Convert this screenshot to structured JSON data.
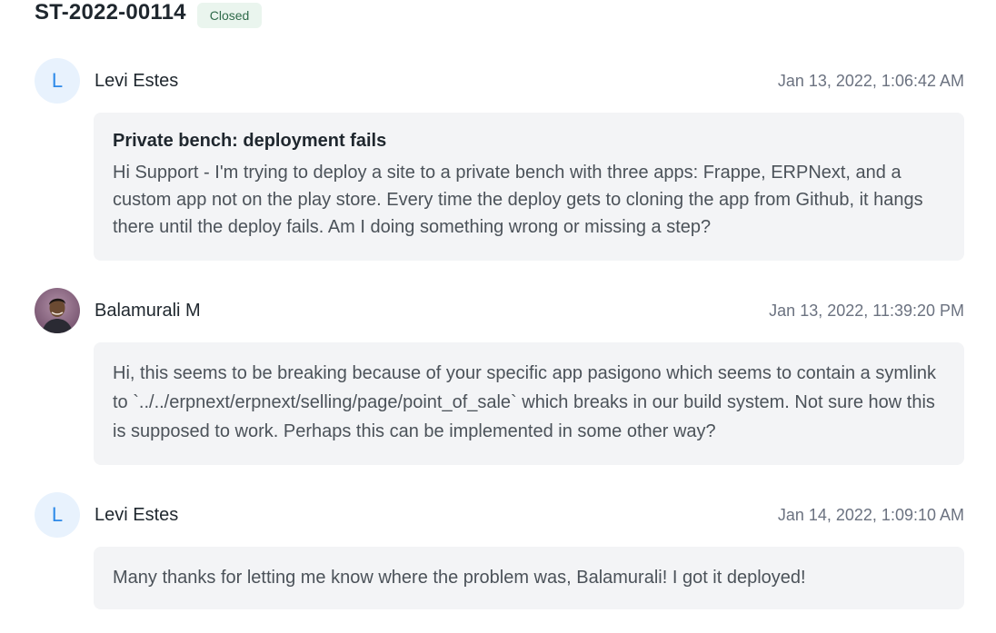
{
  "ticket": {
    "id": "ST-2022-00114",
    "status": "Closed"
  },
  "messages": [
    {
      "avatar_letter": "L",
      "author": "Levi Estes",
      "timestamp": "Jan 13, 2022, 1:06:42 AM",
      "subject": "Private bench: deployment fails",
      "body": "Hi Support - I'm trying to deploy a site to a private bench with three apps: Frappe, ERPNext, and a custom app not on the play store. Every time the deploy gets to cloning the app from Github, it hangs there until the deploy fails. Am I doing something wrong or missing a step?"
    },
    {
      "author": "Balamurali M",
      "timestamp": "Jan 13, 2022, 11:39:20 PM",
      "body": "Hi, this seems to be breaking because of your specific app pasigono which seems to contain a symlink to `../../erpnext/erpnext/selling/page/point_of_sale` which breaks in our build system. Not sure how this is supposed to work. Perhaps this can be implemented in some other way?"
    },
    {
      "avatar_letter": "L",
      "author": "Levi Estes",
      "timestamp": "Jan 14, 2022, 1:09:10 AM",
      "body": "Many thanks for letting me know where the problem was, Balamurali! I got it deployed!"
    }
  ]
}
